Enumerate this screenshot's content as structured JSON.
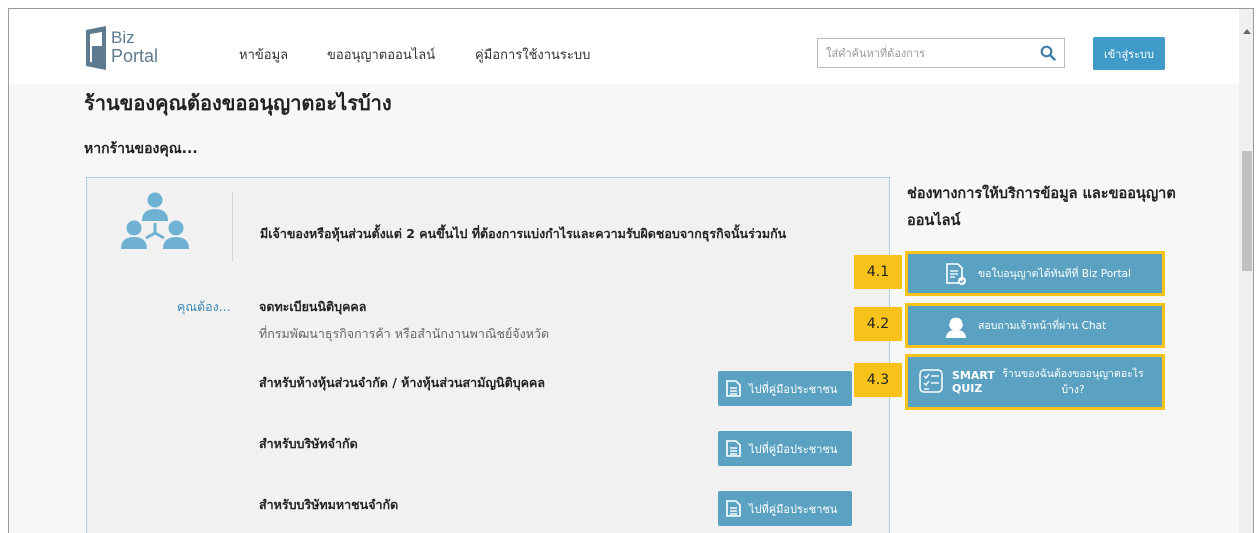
{
  "header": {
    "logo": {
      "line1": "Biz",
      "line2": "Portal"
    },
    "nav": [
      "หาข้อมูล",
      "ขออนุญาตออนไลน์",
      "คู่มือการใช้งานระบบ"
    ],
    "search_placeholder": "ใส่คำค้นหาที่ต้องการ",
    "login_label": "เข้าสู่ระบบ"
  },
  "main": {
    "title": "ร้านของคุณต้องขออนุญาตอะไรบ้าง",
    "subtitle": "หากร้านของคุณ...",
    "card": {
      "description": "มีเจ้าของหรือหุ้นส่วนตั้งแต่ 2 คนขึ้นไป ที่ต้องการแบ่งกำไรและความรับผิดชอบจากธุรกิจนั้นร่วมกัน",
      "you_must": "คุณต้อง...",
      "registration_title": "จดทะเบียนนิติบุคคล",
      "registration_subtitle": "ที่กรมพัฒนาธุรกิจการค้า หรือสำนักงานพาณิชย์จังหวัด",
      "rows": [
        {
          "label": "สำหรับห้างหุ้นส่วนจำกัด / ห้างหุ้นส่วนสามัญนิติบุคคล",
          "button": "ไปที่คู่มือประชาชน"
        },
        {
          "label": "สำหรับบริษัทจำกัด",
          "button": "ไปที่คู่มือประชาชน"
        },
        {
          "label": "สำหรับบริษัทมหาชนจำกัด",
          "button": "ไปที่คู่มือประชาชน"
        }
      ]
    }
  },
  "sidebar": {
    "title": "ช่องทางการให้บริการข้อมูล และขออนุญาตออนไลน์",
    "services": [
      {
        "number": "4.1",
        "label": "ขอใบอนุญาตได้ทันทีที่ Biz Portal",
        "icon": "document-check-icon"
      },
      {
        "number": "4.2",
        "label": "สอบถามเจ้าหน้าที่ผ่าน Chat",
        "icon": "chat-agent-icon"
      },
      {
        "number": "4.3",
        "badge": "SMART QUIZ",
        "label": "ร้านของฉันต้องขออนุญาตอะไรบ้าง?",
        "icon": "checklist-icon"
      }
    ]
  },
  "colors": {
    "accent": "#3f9ac7",
    "button": "#5ba2c2",
    "highlight": "#f7c21a",
    "link": "#3a89b6"
  }
}
